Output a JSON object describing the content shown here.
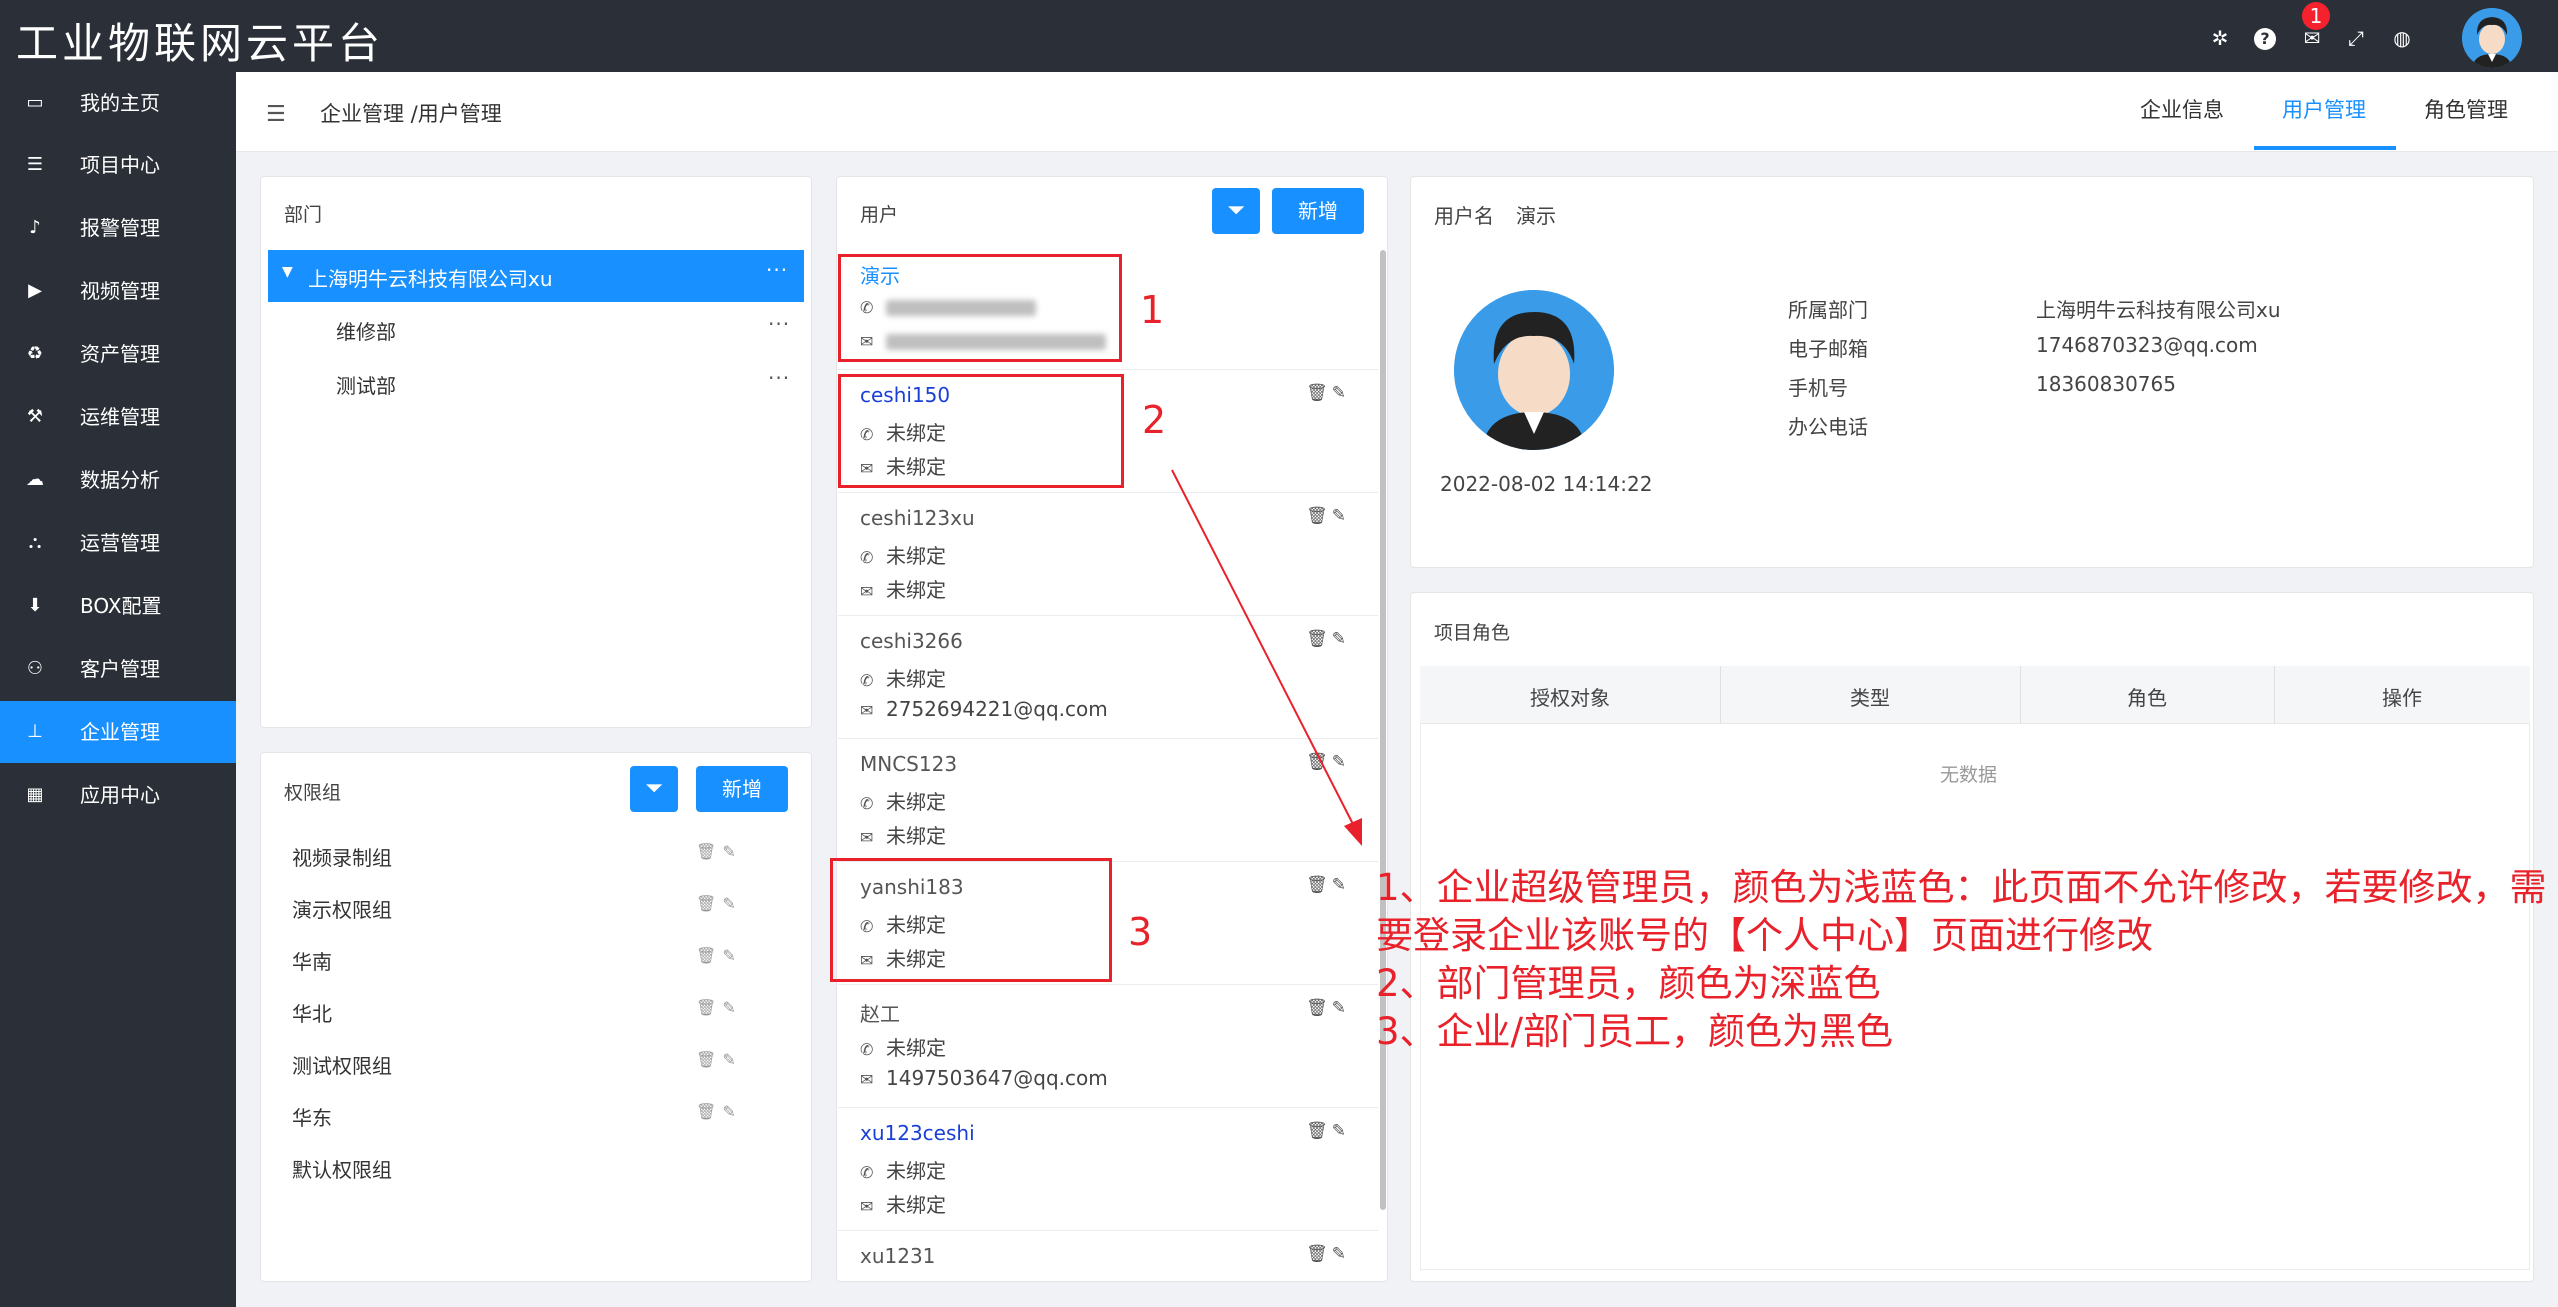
{
  "app": {
    "title": "工业物联网云平台"
  },
  "topbar": {
    "notification_count": "1"
  },
  "sidebar": {
    "items": [
      {
        "label": "我的主页",
        "icon": "laptop-icon"
      },
      {
        "label": "项目中心",
        "icon": "list-icon"
      },
      {
        "label": "报警管理",
        "icon": "bell-icon"
      },
      {
        "label": "视频管理",
        "icon": "video-icon"
      },
      {
        "label": "资产管理",
        "icon": "recycle-icon"
      },
      {
        "label": "运维管理",
        "icon": "wrench-icon"
      },
      {
        "label": "数据分析",
        "icon": "cloud-upload-icon"
      },
      {
        "label": "运营管理",
        "icon": "cubes-icon"
      },
      {
        "label": "BOX配置",
        "icon": "download-icon"
      },
      {
        "label": "客户管理",
        "icon": "users-icon"
      },
      {
        "label": "企业管理",
        "icon": "sitemap-icon",
        "active": true
      },
      {
        "label": "应用中心",
        "icon": "grid-icon"
      }
    ]
  },
  "header": {
    "breadcrumb": "企业管理 /用户管理",
    "tabs": [
      {
        "label": "企业信息"
      },
      {
        "label": "用户管理",
        "active": true
      },
      {
        "label": "角色管理"
      }
    ]
  },
  "dept": {
    "title": "部门",
    "root": "上海明牛云科技有限公司xu",
    "children": [
      "维修部",
      "测试部"
    ]
  },
  "perm": {
    "title": "权限组",
    "add_label": "新增",
    "items": [
      "视频录制组",
      "演示权限组",
      "华南",
      "华北",
      "测试权限组",
      "华东",
      "默认权限组"
    ]
  },
  "users": {
    "title": "用户",
    "add_label": "新增",
    "items": [
      {
        "name": "演示",
        "phone": "",
        "email": "",
        "color": "#1890ff"
      },
      {
        "name": "ceshi150",
        "phone": "未绑定",
        "email": "未绑定",
        "color": "#1a3fd6"
      },
      {
        "name": "ceshi123xu",
        "phone": "未绑定",
        "email": "未绑定",
        "color": "#555555"
      },
      {
        "name": "ceshi3266",
        "phone": "未绑定",
        "email": "2752694221@qq.com",
        "color": "#555555"
      },
      {
        "name": "MNCS123",
        "phone": "未绑定",
        "email": "未绑定",
        "color": "#555555"
      },
      {
        "name": "yanshi183",
        "phone": "未绑定",
        "email": "未绑定",
        "color": "#555555"
      },
      {
        "name": "赵工",
        "phone": "未绑定",
        "email": "1497503647@qq.com",
        "color": "#555555"
      },
      {
        "name": "xu123ceshi",
        "phone": "未绑定",
        "email": "未绑定",
        "color": "#1a3fd6"
      },
      {
        "name": "xu1231",
        "phone": "",
        "email": "",
        "color": "#555555"
      }
    ]
  },
  "detail": {
    "username_label": "用户名",
    "username": "演示",
    "created": "2022-08-02 14:14:22",
    "fields": [
      {
        "label": "所属部门",
        "value": "上海明牛云科技有限公司xu"
      },
      {
        "label": "电子邮箱",
        "value": "1746870323@qq.com"
      },
      {
        "label": "手机号",
        "value": "18360830765"
      },
      {
        "label": "办公电话",
        "value": ""
      }
    ]
  },
  "roles": {
    "title": "项目角色",
    "columns": [
      "授权对象",
      "类型",
      "角色",
      "操作"
    ],
    "empty": "无数据"
  },
  "annotation": {
    "numbers": [
      "1",
      "2",
      "3"
    ],
    "lines": [
      "1、企业超级管理员，颜色为浅蓝色：此页面不允许修改，若要修改，需",
      "要登录企业该账号的【个人中心】页面进行修改",
      "2、部门管理员，颜色为深蓝色",
      "3、企业/部门员工，颜色为黑色"
    ],
    "color": "#e8212a"
  }
}
